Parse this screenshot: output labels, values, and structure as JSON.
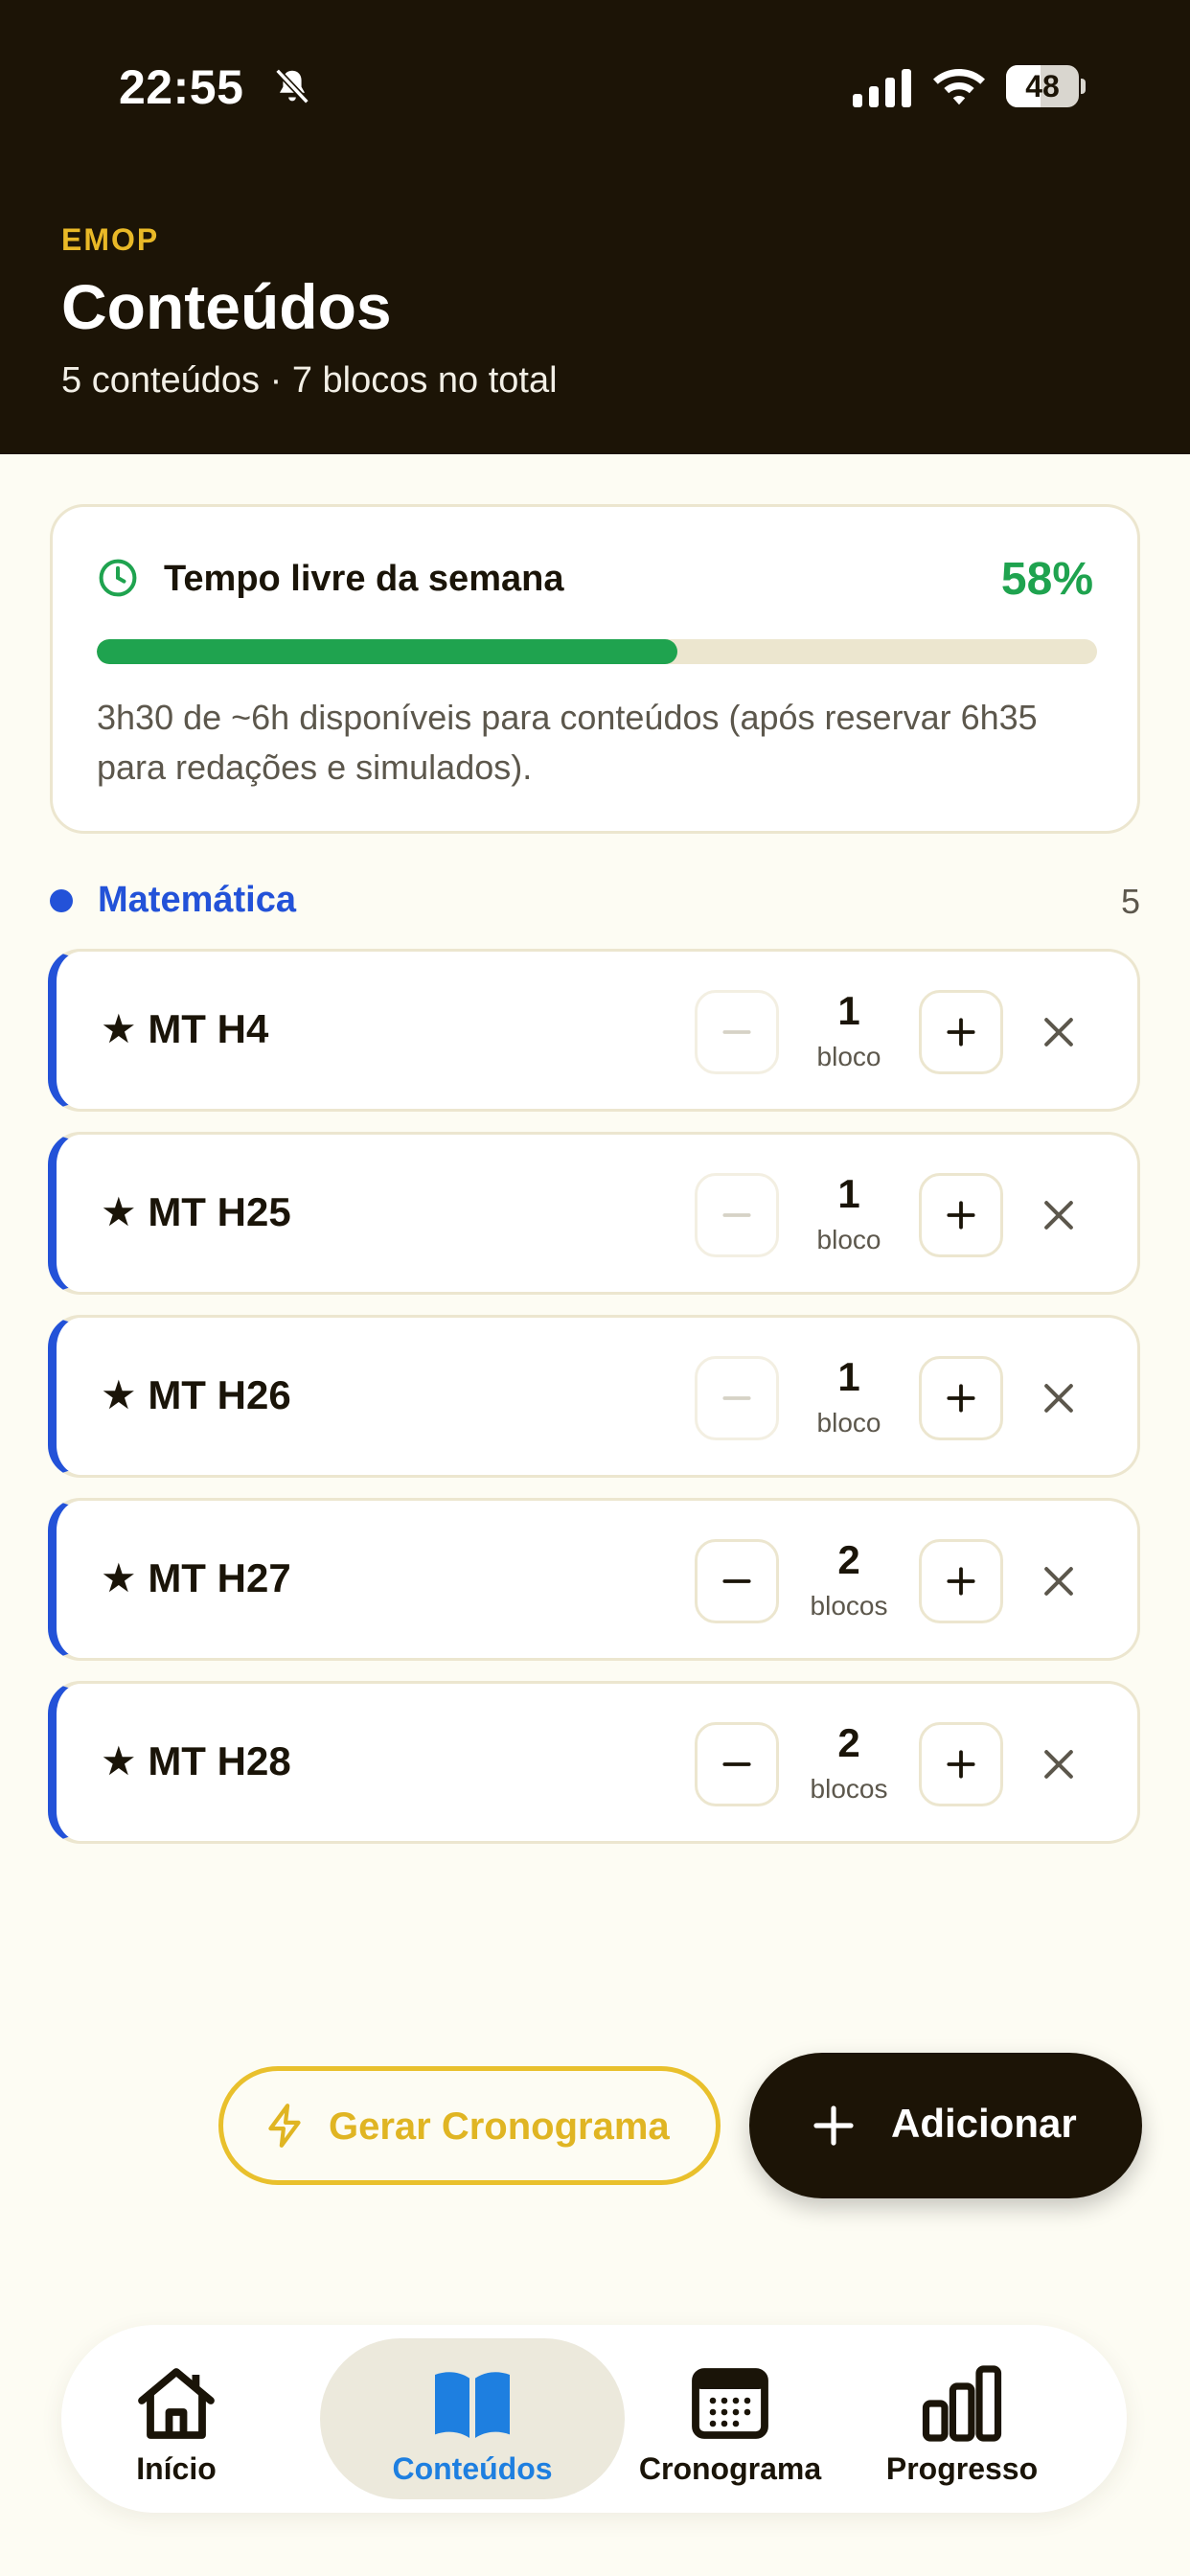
{
  "status_bar": {
    "time": "22:55",
    "battery": "48",
    "battery_level": 48
  },
  "header": {
    "brand": "EMOP",
    "title": "Conteúdos",
    "subtitle": "5 conteúdos · 7 blocos no total"
  },
  "progress": {
    "title": "Tempo livre da semana",
    "percent_label": "58%",
    "percent": 58,
    "description": "3h30 de ~6h disponíveis para conteúdos (após reservar 6h35 para redações e simulados)."
  },
  "section": {
    "title": "Matemática",
    "count": "5",
    "color": "#2352d8"
  },
  "items": [
    {
      "title": "★ MT H4",
      "qty": "1",
      "unit": "bloco",
      "minus_enabled": false
    },
    {
      "title": "★ MT H25",
      "qty": "1",
      "unit": "bloco",
      "minus_enabled": false
    },
    {
      "title": "★ MT H26",
      "qty": "1",
      "unit": "bloco",
      "minus_enabled": false
    },
    {
      "title": "★ MT H27",
      "qty": "2",
      "unit": "blocos",
      "minus_enabled": true
    },
    {
      "title": "★ MT H28",
      "qty": "2",
      "unit": "blocos",
      "minus_enabled": true
    }
  ],
  "actions": {
    "generate_label": "Gerar Cronograma",
    "add_label": "Adicionar"
  },
  "nav": [
    {
      "label": "Início",
      "icon": "home-icon",
      "active": false
    },
    {
      "label": "Conteúdos",
      "icon": "book-icon",
      "active": true
    },
    {
      "label": "Cronograma",
      "icon": "calendar-icon",
      "active": false
    },
    {
      "label": "Progresso",
      "icon": "bar-chart-icon",
      "active": false
    }
  ],
  "colors": {
    "header_bg": "#1c1406",
    "accent_yellow": "#e9b927",
    "success_green": "#1fa34f",
    "section_blue": "#2352d8",
    "nav_active": "#1e7fe0"
  }
}
